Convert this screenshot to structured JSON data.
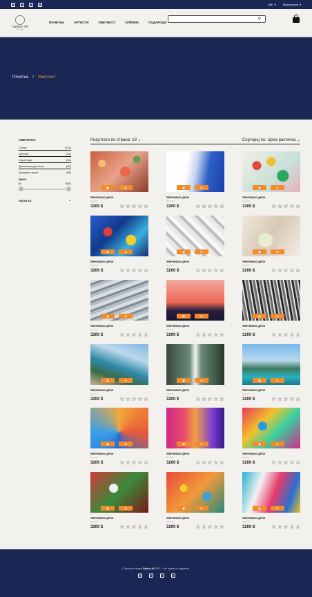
{
  "topbar": {
    "social_icons": [
      "instagram-icon",
      "facebook-icon",
      "twitter-icon",
      "pinterest-icon"
    ],
    "currency": "УДЕ",
    "language": "Македонски"
  },
  "header": {
    "logo_text": "Gallery 94",
    "logo_subtext": "art & design",
    "nav": [
      "ПОЧЕТНА",
      "АРТИСТИ",
      "УМЕТНОСТ",
      "ОПРЕМА",
      "ПОДАРОЦИ"
    ],
    "search_placeholder": ""
  },
  "breadcrumb": {
    "home": "Почетна",
    "separator": "/",
    "current": "Уметност"
  },
  "sidebar": {
    "title": "УМЕТНОСТ",
    "categories": [
      {
        "label": "Слики",
        "count": "(122)"
      },
      {
        "label": "Цртежи",
        "count": "(12)"
      },
      {
        "label": "Скулптури",
        "count": "(24)"
      },
      {
        "label": "Дигитална уметност",
        "count": "(36)"
      },
      {
        "label": "Домашен укаст",
        "count": "(38)"
      }
    ],
    "price_title": "Цена",
    "price_min": "$0",
    "price_max": "$900",
    "price_range_fraction": [
      0.0,
      1.0
    ],
    "artists_label": "Артисти"
  },
  "toolbar": {
    "results_label": "Резултати по страна: 18",
    "sort_label": "Сортирај по: Цена растечка"
  },
  "products": [
    {
      "title": "Уметничко дело",
      "artist": "Артист",
      "price": "3200 $"
    },
    {
      "title": "Уметничко дело",
      "artist": "Артист",
      "price": "3200 $"
    },
    {
      "title": "Уметничко дело",
      "artist": "Артист",
      "price": "3200 $"
    },
    {
      "title": "Уметничко дело",
      "artist": "Артист",
      "price": "3200 $"
    },
    {
      "title": "Уметничко дело",
      "artist": "Артист",
      "price": "3200 $"
    },
    {
      "title": "Уметничко дело",
      "artist": "Артист",
      "price": "3200 $"
    },
    {
      "title": "Уметничко дело",
      "artist": "Артист",
      "price": "3200 $"
    },
    {
      "title": "Уметничко дело",
      "artist": "Артист",
      "price": "3200 $"
    },
    {
      "title": "Уметничко дело",
      "artist": "Артист",
      "price": "3200 $"
    },
    {
      "title": "Уметничко дело",
      "artist": "Артист",
      "price": "3200 $"
    },
    {
      "title": "Уметничко дело",
      "artist": "Артист",
      "price": "3200 $"
    },
    {
      "title": "Уметничко дело",
      "artist": "Артист",
      "price": "3200 $"
    },
    {
      "title": "Уметничко дело",
      "artist": "Артист",
      "price": "3200 $"
    },
    {
      "title": "Уметничко дело",
      "artist": "Артист",
      "price": "3200 $"
    },
    {
      "title": "Уметничко дело",
      "artist": "Артист",
      "price": "3200 $"
    },
    {
      "title": "Уметничко дело",
      "artist": "Артист",
      "price": "3200 $"
    },
    {
      "title": "Уметничко дело",
      "artist": "Артист",
      "price": "3200 $"
    },
    {
      "title": "Уметничко дело",
      "artist": "Артист",
      "price": "3200 $"
    }
  ],
  "footer": {
    "copyright_prefix": "© Авторски права",
    "brand": "Gallery 94",
    "copyright_suffix": "2021. Сите права се задржани."
  },
  "colors": {
    "navy": "#1a2653",
    "accent": "#f08c2e",
    "background": "#f3f1ed"
  }
}
